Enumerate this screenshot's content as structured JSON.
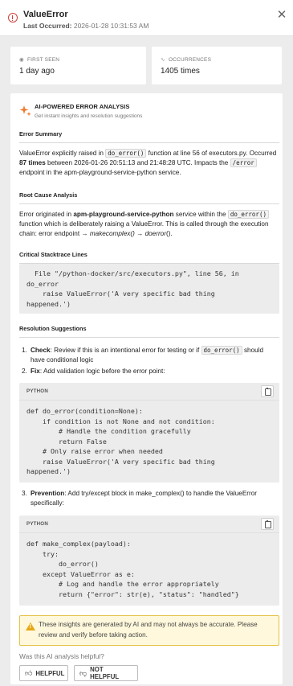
{
  "header": {
    "title": "ValueError",
    "last_occurred_label": "Last Occurred:",
    "last_occurred_value": "2026-01-28 10:31:53 AM"
  },
  "stats": {
    "first_seen_label": "FIRST SEEN",
    "first_seen_value": "1 day ago",
    "occurrences_label": "OCCURRENCES",
    "occurrences_value": "1405 times"
  },
  "analysis": {
    "title": "AI-POWERED ERROR ANALYSIS",
    "subtitle": "Get instant insights and resolution suggestions",
    "summary_heading": "Error Summary",
    "summary": {
      "p1": "ValueError explicitly raised in ",
      "code1": "do_error()",
      "p2": " function at line 56 of executors.py. Occurred ",
      "count": "87 times",
      "p3": " between 2026-01-26 20:51:13 and 21:48:28 UTC. Impacts the ",
      "code2": "/error",
      "p4": " endpoint in the apm-playground-service-python service."
    },
    "root_heading": "Root Cause Analysis",
    "root": {
      "p1": "Error originated in ",
      "service": "apm-playground-service-python",
      "p2": " service within the ",
      "code1": "do_error()",
      "p3": " function which is deliberately raising a ValueError. This is called through the execution chain: error endpoint → ",
      "fn1": "makecomplex()",
      "p4": " → ",
      "fn2": "doerror",
      "p5": "()."
    },
    "stack_heading": "Critical Stacktrace Lines",
    "stack": "  File \"/python-docker/src/executors.py\", line 56, in\ndo_error\n    raise ValueError('A very specific bad thing\nhappened.')",
    "resolution_heading": "Resolution Suggestions",
    "steps": [
      {
        "num": "1.",
        "title": "Check",
        "text_a": ": Review if this is an intentional error for testing or if ",
        "code": "do_error()",
        "text_b": " should have conditional logic"
      },
      {
        "num": "2.",
        "title": "Fix",
        "text": ": Add validation logic before the error point:"
      },
      {
        "num": "3.",
        "title": "Prevention",
        "text": ": Add try/except block in make_complex() to handle the ValueError specifically:"
      }
    ],
    "code_blocks": [
      {
        "lang": "PYTHON",
        "code": "def do_error(condition=None):\n    if condition is not None and not condition:\n        # Handle the condition gracefully\n        return False\n    # Only raise error when needed\n    raise ValueError('A very specific bad thing\nhappened.')"
      },
      {
        "lang": "PYTHON",
        "code": "def make_complex(payload):\n    try:\n        do_error()\n    except ValueError as e:\n        # Log and handle the error appropriately\n        return {\"error\": str(e), \"status\": \"handled\"}"
      }
    ],
    "warning": "These insights are generated by AI and may not always be accurate. Please review and verify before taking action.",
    "feedback_question": "Was this AI analysis helpful?",
    "helpful_label": "HELPFUL",
    "not_helpful_label": "NOT HELPFUL"
  },
  "icons": {
    "error": "error-circle-icon",
    "close": "close-icon",
    "eye": "eye-icon",
    "activity": "activity-icon",
    "sparkle": "sparkle-icon",
    "copy": "copy-icon",
    "warning": "warning-icon",
    "thumbs_up": "thumbs-up-icon",
    "thumbs_down": "thumbs-down-icon"
  },
  "colors": {
    "error": "#d0403a",
    "sparkle": "#f07a2a",
    "warning_bg": "#fff8dc",
    "warning_border": "#e4c24a"
  }
}
